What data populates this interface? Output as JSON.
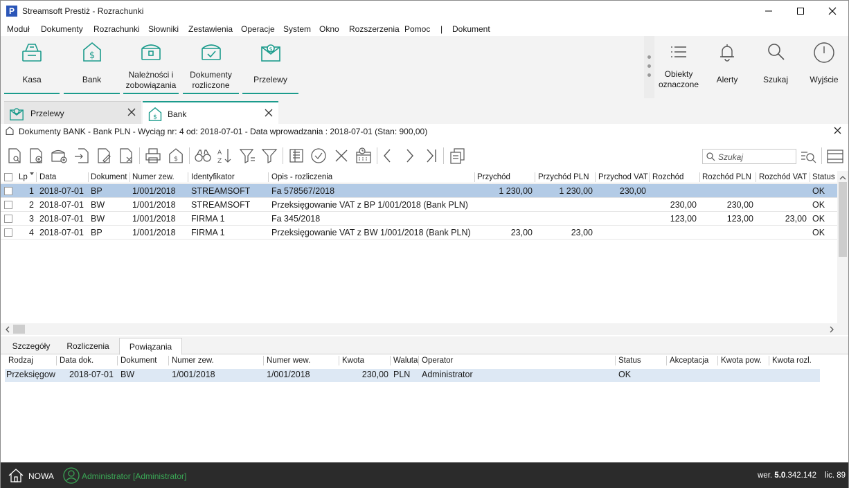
{
  "window": {
    "title": "Streamsoft Prestiż - Rozrachunki",
    "app_icon_letter": "P"
  },
  "menu": [
    "Moduł",
    "Dokumenty",
    "Rozrachunki",
    "Słowniki",
    "Zestawienia",
    "Operacje",
    "System",
    "Okno",
    "Rozszerzenia",
    "Pomoc",
    "|",
    "Dokument"
  ],
  "ribbon": {
    "left_buttons": [
      {
        "label": "Kasa",
        "icon": "cash-register-icon"
      },
      {
        "label": "Bank",
        "icon": "bank-icon"
      },
      {
        "label": "Należności i zobowiązania",
        "icon": "chest-icon"
      },
      {
        "label": "Dokumenty rozliczone",
        "icon": "chest-check-icon"
      },
      {
        "label": "Przelewy",
        "icon": "transfer-envelope-icon"
      }
    ],
    "right_buttons": [
      {
        "label": "Obiekty oznaczone",
        "icon": "list-icon"
      },
      {
        "label": "Alerty",
        "icon": "bell-icon"
      },
      {
        "label": "Szukaj",
        "icon": "search-icon"
      },
      {
        "label": "Wyjście",
        "icon": "power-icon"
      }
    ],
    "accent_color": "#1b9b8c"
  },
  "tabs": [
    {
      "label": "Przelewy",
      "active": false
    },
    {
      "label": "Bank",
      "active": true
    }
  ],
  "document_header": "Dokumenty BANK - Bank PLN - Wyciąg nr: 4 od: 2018-07-01 - Data wprowadzania : 2018-07-01    (Stan: 900,00)",
  "search": {
    "placeholder": "Szukaj"
  },
  "grid": {
    "columns": [
      "Lp",
      "Data",
      "Dokument",
      "Numer zew.",
      "Identyfikator",
      "Opis - rozliczenia",
      "Przychód",
      "Przychód PLN",
      "Przychod VAT",
      "Rozchód",
      "Rozchód PLN",
      "Rozchód VAT",
      "Status"
    ],
    "rows": [
      {
        "lp": "1",
        "data": "2018-07-01",
        "dokument": "BP",
        "numer": "1/001/2018",
        "identyfikator": "STREAMSOFT",
        "opis": "Fa 578567/2018",
        "przychod": "1 230,00",
        "przychod_pln": "1 230,00",
        "przychod_vat": "230,00",
        "rozchod": "",
        "rozchod_pln": "",
        "rozchod_vat": "",
        "status": "OK"
      },
      {
        "lp": "2",
        "data": "2018-07-01",
        "dokument": "BW",
        "numer": "1/001/2018",
        "identyfikator": "STREAMSOFT",
        "opis": "Przeksięgowanie VAT z BP 1/001/2018 (Bank PLN)",
        "przychod": "",
        "przychod_pln": "",
        "przychod_vat": "",
        "rozchod": "230,00",
        "rozchod_pln": "230,00",
        "rozchod_vat": "",
        "status": "OK"
      },
      {
        "lp": "3",
        "data": "2018-07-01",
        "dokument": "BW",
        "numer": "1/001/2018",
        "identyfikator": "FIRMA 1",
        "opis": "Fa 345/2018",
        "przychod": "",
        "przychod_pln": "",
        "przychod_vat": "",
        "rozchod": "123,00",
        "rozchod_pln": "123,00",
        "rozchod_vat": "23,00",
        "status": "OK"
      },
      {
        "lp": "4",
        "data": "2018-07-01",
        "dokument": "BP",
        "numer": "1/001/2018",
        "identyfikator": "FIRMA 1",
        "opis": "Przeksięgowanie VAT z BW 1/001/2018 (Bank PLN)",
        "przychod": "23,00",
        "przychod_pln": "23,00",
        "przychod_vat": "",
        "rozchod": "",
        "rozchod_pln": "",
        "rozchod_vat": "",
        "status": "OK"
      }
    ],
    "selected_color": "#b3cbe6"
  },
  "bottom_tabs": [
    {
      "label": "Szczegóły",
      "active": false
    },
    {
      "label": "Rozliczenia",
      "active": false
    },
    {
      "label": "Powiązania",
      "active": true
    }
  ],
  "bottom_grid": {
    "columns": [
      "Rodzaj",
      "Data dok.",
      "Dokument",
      "Numer zew.",
      "Numer wew.",
      "Kwota",
      "Waluta",
      "Operator",
      "Status",
      "Akceptacja",
      "Kwota pow.",
      "Kwota rozl."
    ],
    "rows": [
      {
        "rodzaj": "Przeksięgow",
        "data": "2018-07-01",
        "dokument": "BW",
        "numer_zew": "1/001/2018",
        "numer_wew": "1/001/2018",
        "kwota": "230,00",
        "waluta": "PLN",
        "operator": "Administrator",
        "status": "OK",
        "akceptacja": "",
        "kwota_pow": "",
        "kwota_rozl": ""
      }
    ]
  },
  "statusbar": {
    "mode": "NOWA",
    "user": "Administrator [Administrator]",
    "version_prefix": "wer. ",
    "version_bold": "5.0",
    "version_rest": ".342.142",
    "license": "lic. 89"
  }
}
